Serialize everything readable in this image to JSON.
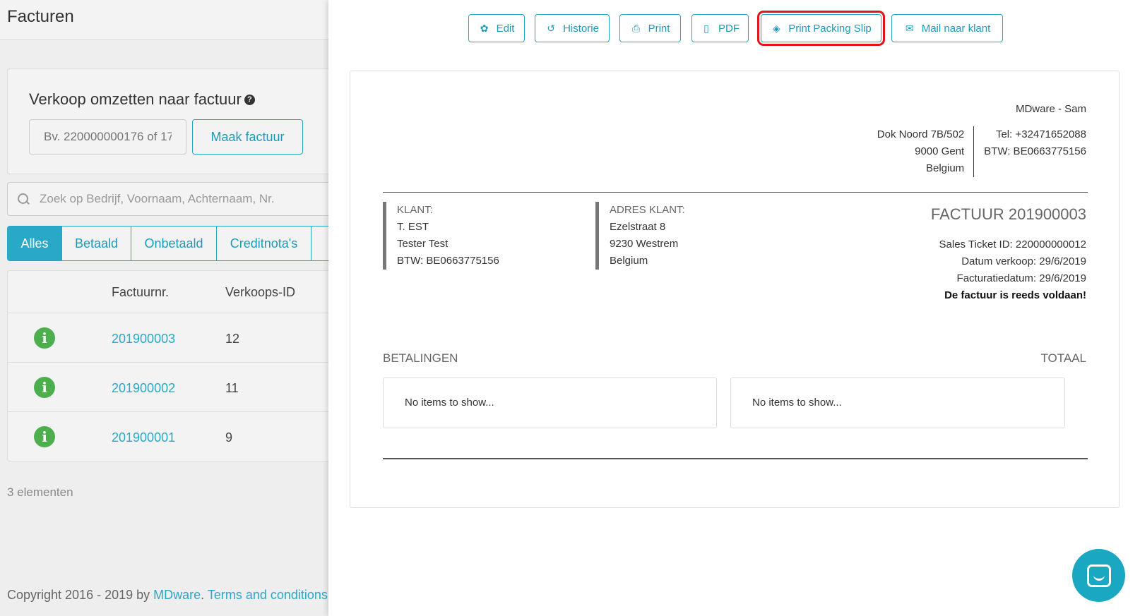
{
  "left": {
    "title": "Facturen",
    "convert": {
      "title": "Verkoop omzetten naar factuur",
      "help_icon": "?",
      "input_placeholder": "Bv. 220000000176 of 17",
      "button": "Maak factuur"
    },
    "search": {
      "placeholder": "Zoek op Bedrijf, Voornaam, Achternaam, Nr."
    },
    "tabs": [
      "Alles",
      "Betaald",
      "Onbetaald",
      "Creditnota's"
    ],
    "table": {
      "columns": [
        "Factuurnr.",
        "Verkoops-ID"
      ],
      "rows": [
        {
          "nr": "201900003",
          "id": "12"
        },
        {
          "nr": "201900002",
          "id": "11"
        },
        {
          "nr": "201900001",
          "id": "9"
        }
      ]
    },
    "count": "3 elementen",
    "footer": {
      "text": "Copyright 2016 - 2019 by ",
      "brand": "MDware",
      "sep": ". ",
      "terms": "Terms and conditions",
      "dash": " -"
    }
  },
  "toolbar": {
    "edit": "Edit",
    "historie": "Historie",
    "print": "Print",
    "pdf": "PDF",
    "packing": "Print Packing Slip",
    "mail": "Mail naar klant"
  },
  "invoice": {
    "company": "MDware - Sam",
    "address": [
      "Dok Noord 7B/502",
      "9000 Gent",
      "Belgium"
    ],
    "contact": [
      "Tel: +32471652088",
      "BTW: BE0663775156"
    ],
    "klant": {
      "label": "KLANT:",
      "lines": [
        "T. EST",
        "Tester Test",
        "BTW: BE0663775156"
      ]
    },
    "adres_klant": {
      "label": "ADRES KLANT:",
      "lines": [
        "Ezelstraat 8",
        "9230 Westrem",
        "Belgium"
      ]
    },
    "title": "FACTUUR 201900003",
    "meta": [
      "Sales Ticket ID: 220000000012",
      "Datum verkoop: 29/6/2019",
      "Facturatiedatum: 29/6/2019"
    ],
    "paid_note": "De factuur is reeds voldaan!",
    "betalingen": "BETALINGEN",
    "totaal": "TOTAAL",
    "empty": "No items to show..."
  },
  "colors": {
    "accent": "#2aa8c7",
    "highlight": "#e0141b",
    "info_green": "#4cae4c"
  }
}
